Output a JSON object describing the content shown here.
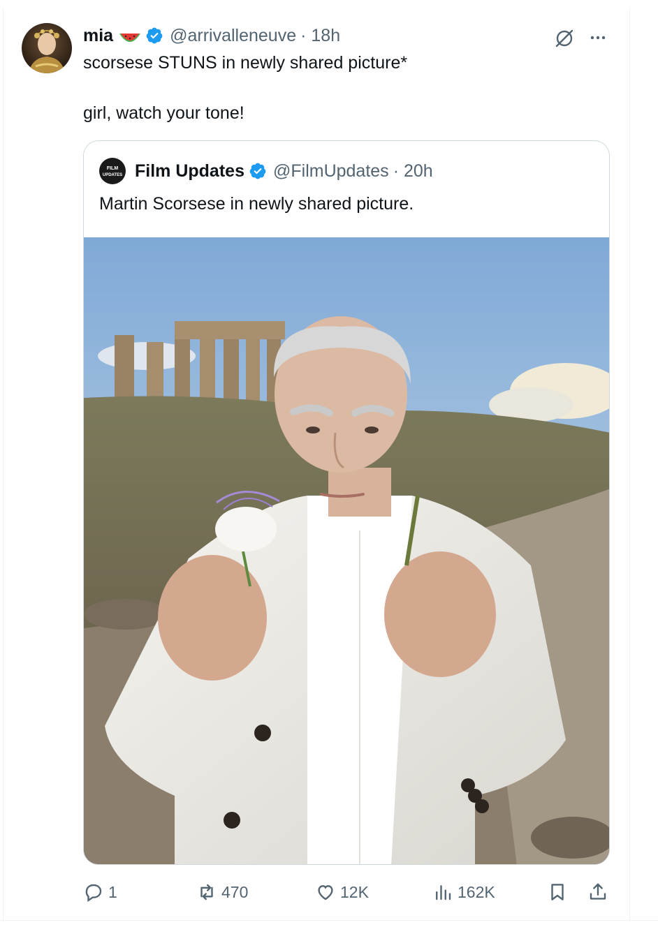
{
  "tweet": {
    "author_name": "mia",
    "author_emoji": "watermelon",
    "author_handle": "@arrivalleneuve",
    "time": "· 18h",
    "line1": "scorsese STUNS in newly shared picture*",
    "line2": "girl, watch your tone!"
  },
  "quoted": {
    "avatar_text": "FILM UPDATES",
    "author_name": "Film Updates",
    "author_handle": "@FilmUpdates",
    "time": "· 20h",
    "text": "Martin Scorsese in newly shared picture."
  },
  "actions": {
    "replies": "1",
    "reposts": "470",
    "likes": "12K",
    "views": "162K"
  },
  "icons": [
    "grok-icon",
    "more-icon",
    "verified-icon",
    "reply-icon",
    "repost-icon",
    "like-icon",
    "views-icon",
    "bookmark-icon",
    "share-icon"
  ],
  "colors": {
    "verified": "#1d9bf0",
    "secondary_text": "#536471",
    "border": "#cfd9de"
  }
}
